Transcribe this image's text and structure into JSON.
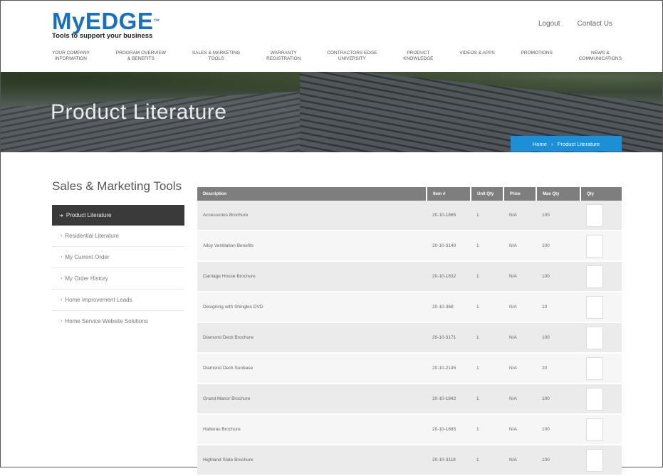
{
  "brand": {
    "name": "MyEDGE",
    "trademark": "™",
    "tagline": "Tools to support your business"
  },
  "top_links": {
    "logout": "Logout",
    "contact": "Contact Us"
  },
  "nav": [
    "YOUR COMPANY\nINFORMATION",
    "PROGRAM OVERVIEW\n& BENEFITS",
    "SALES & MARKETING\nTOOLS",
    "WARRANTY\nREGISTRATION",
    "CONTRACTORS EDGE\nUNIVERSITY",
    "PRODUCT\nKNOWLEDGE",
    "VIDEOS & APPS",
    "PROMOTIONS",
    "NEWS &\nCOMMUNICATIONS"
  ],
  "hero": {
    "title": "Product Literature",
    "breadcrumb_home": "Home",
    "breadcrumb_sep": "›",
    "breadcrumb_current": "Product Literature"
  },
  "sidebar": {
    "title": "Sales & Marketing Tools",
    "items": [
      {
        "label": "Product Literature",
        "active": true
      },
      {
        "label": "Residential Literature",
        "active": false
      },
      {
        "label": "My Current Order",
        "active": false
      },
      {
        "label": "My Order History",
        "active": false
      },
      {
        "label": "Home Improvement Leads",
        "active": false
      },
      {
        "label": "Home Service Website Solutions",
        "active": false
      }
    ]
  },
  "table": {
    "headers": [
      "Description",
      "Item #",
      "Unit Qty",
      "Price",
      "Max Qty",
      "Qty"
    ],
    "rows": [
      {
        "description": "Accessories Brochure",
        "item": "20-10-1865",
        "unit": "1",
        "price": "N/A",
        "max": "100"
      },
      {
        "description": "Alloy Ventilation Benefits",
        "item": "20-10-3140",
        "unit": "1",
        "price": "N/A",
        "max": "100"
      },
      {
        "description": "Carriage House Brochure",
        "item": "20-10-1832",
        "unit": "1",
        "price": "N/A",
        "max": "100"
      },
      {
        "description": "Designing with Shingles DVD",
        "item": "20-10-368",
        "unit": "1",
        "price": "N/A",
        "max": "10"
      },
      {
        "description": "Diamond Deck Brochure",
        "item": "20-10-3171",
        "unit": "1",
        "price": "N/A",
        "max": "100"
      },
      {
        "description": "Diamond Deck Sunbase",
        "item": "20-10-2145",
        "unit": "1",
        "price": "N/A",
        "max": "20"
      },
      {
        "description": "Grand Manor Brochure",
        "item": "20-10-1842",
        "unit": "1",
        "price": "N/A",
        "max": "100"
      },
      {
        "description": "Hatteras Brochure",
        "item": "20-10-1885",
        "unit": "1",
        "price": "N/A",
        "max": "100"
      },
      {
        "description": "Highland Slate Brochure",
        "item": "20-10-3118",
        "unit": "1",
        "price": "N/A",
        "max": "100"
      }
    ]
  }
}
